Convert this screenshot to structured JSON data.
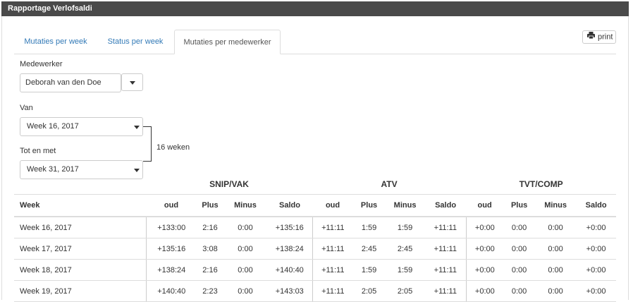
{
  "window": {
    "title": "Rapportage Verlofsaldi"
  },
  "tabs": [
    {
      "label": "Mutaties per week",
      "active": false
    },
    {
      "label": "Status per week",
      "active": false
    },
    {
      "label": "Mutaties per medewerker",
      "active": true
    }
  ],
  "print": {
    "label": "print",
    "icon": "printer-icon"
  },
  "employee": {
    "label": "Medewerker",
    "value": "Deborah van den Doe"
  },
  "from": {
    "label": "Van",
    "value": "Week 16, 2017"
  },
  "to": {
    "label": "Tot en met",
    "value": "Week 31, 2017"
  },
  "range": {
    "label": "16 weken"
  },
  "table": {
    "groups": [
      "SNIP/VAK",
      "ATV",
      "TVT/COMP"
    ],
    "columns": [
      "Week",
      "oud",
      "Plus",
      "Minus",
      "Saldo",
      "oud",
      "Plus",
      "Minus",
      "Saldo",
      "oud",
      "Plus",
      "Minus",
      "Saldo"
    ],
    "rows": [
      [
        "Week 16, 2017",
        "+133:00",
        "2:16",
        "0:00",
        "+135:16",
        "+11:11",
        "1:59",
        "1:59",
        "+11:11",
        "+0:00",
        "0:00",
        "0:00",
        "+0:00"
      ],
      [
        "Week 17, 2017",
        "+135:16",
        "3:08",
        "0:00",
        "+138:24",
        "+11:11",
        "2:45",
        "2:45",
        "+11:11",
        "+0:00",
        "0:00",
        "0:00",
        "+0:00"
      ],
      [
        "Week 18, 2017",
        "+138:24",
        "2:16",
        "0:00",
        "+140:40",
        "+11:11",
        "1:59",
        "1:59",
        "+11:11",
        "+0:00",
        "0:00",
        "0:00",
        "+0:00"
      ],
      [
        "Week 19, 2017",
        "+140:40",
        "2:23",
        "0:00",
        "+143:03",
        "+11:11",
        "2:05",
        "2:05",
        "+11:11",
        "+0:00",
        "0:00",
        "0:00",
        "+0:00"
      ]
    ]
  }
}
